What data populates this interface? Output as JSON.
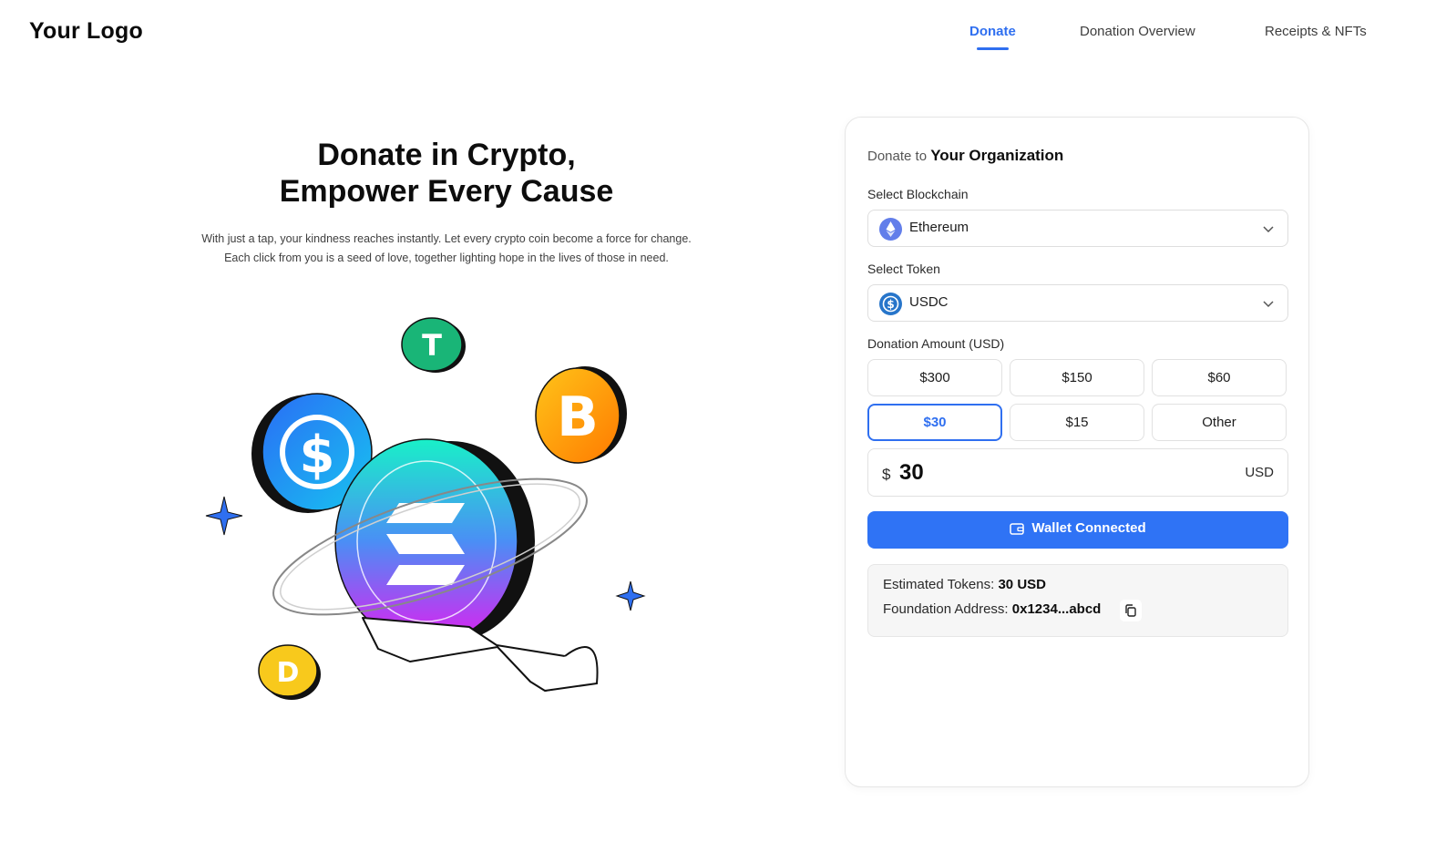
{
  "header": {
    "logo": "Your Logo",
    "nav": [
      {
        "label": "Donate",
        "active": true
      },
      {
        "label": "Donation Overview",
        "active": false
      },
      {
        "label": "Receipts & NFTs",
        "active": false
      }
    ]
  },
  "hero": {
    "title_line1": "Donate in Crypto,",
    "title_line2": "Empower Every Cause",
    "subtitle_line1": "With just a tap, your kindness reaches instantly. Let every crypto coin become a force for change.",
    "subtitle_line2": "Each click from you is a seed of love, together lighting hope in the lives of those in need."
  },
  "donation_card": {
    "title_prefix": "Donate to",
    "organization": "Your Organization",
    "blockchain_label": "Select Blockchain",
    "blockchain_value": "Ethereum",
    "token_label": "Select Token",
    "token_value": "USDC",
    "amount_label": "Donation Amount (USD)",
    "amount_options": [
      "$300",
      "$150",
      "$60",
      "$30",
      "$15",
      "Other"
    ],
    "selected_option": "$30",
    "currency_symbol": "$",
    "amount_value": "30",
    "amount_unit": "USD",
    "wallet_button": "Wallet Connected",
    "estimated_tokens_label": "Estimated Tokens:",
    "estimated_tokens_value": "30 USD",
    "foundation_address_label": "Foundation Address:",
    "foundation_address_value": "0x1234...abcd"
  },
  "icons": [
    "ethereum-icon",
    "usdc-icon",
    "chevron-down-icon",
    "wallet-icon",
    "copy-icon"
  ],
  "colors": {
    "accent": "#2f6ff0",
    "button": "#2f73f5",
    "info_bg": "#f6f6f6"
  }
}
